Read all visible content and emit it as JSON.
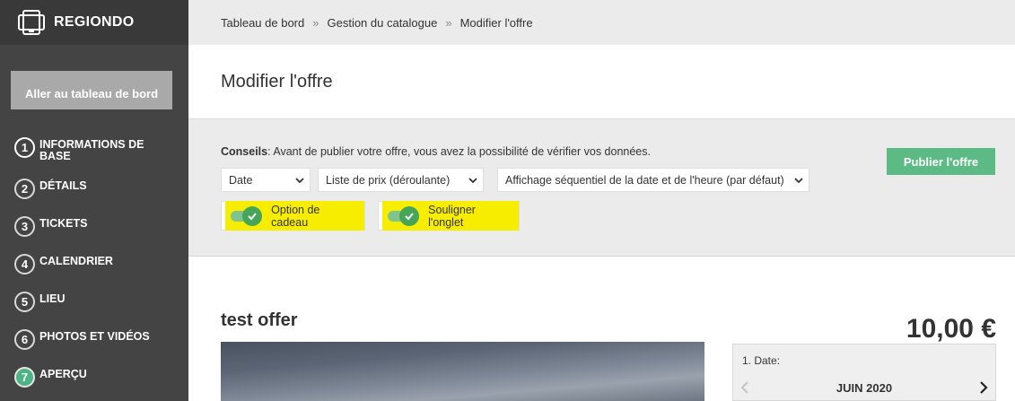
{
  "brand": {
    "name": "REGIONDO"
  },
  "sidebar": {
    "dashboard_button": "Aller au tableau de bord",
    "steps": [
      {
        "num": "1",
        "label": "INFORMATIONS DE BASE"
      },
      {
        "num": "2",
        "label": "DÉTAILS"
      },
      {
        "num": "3",
        "label": "TICKETS"
      },
      {
        "num": "4",
        "label": "CALENDRIER"
      },
      {
        "num": "5",
        "label": "LIEU"
      },
      {
        "num": "6",
        "label": "PHOTOS ET VIDÉOS"
      },
      {
        "num": "7",
        "label": "APERÇU"
      }
    ]
  },
  "breadcrumb": {
    "items": [
      "Tableau de bord",
      "Gestion du catalogue",
      "Modifier l'offre"
    ],
    "separator": "»"
  },
  "page": {
    "title": "Modifier l'offre"
  },
  "tips": {
    "prefix": "Conseils",
    "text": ": Avant de publier votre offre, vous avez la possibilité de vérifier vos données."
  },
  "selects": {
    "date": "Date",
    "price_list": "Liste de prix (déroulante)",
    "display": "Affichage séquentiel de la date et de l'heure (par défaut)"
  },
  "toggles": {
    "gift_option": {
      "label": "Option de cadeau",
      "on": true
    },
    "underline_tab": {
      "label": "Souligner l'onglet",
      "on": true
    }
  },
  "publish_button": "Publier l'offre",
  "offer": {
    "title": "test offer",
    "price": "10,00 €",
    "date_label": "1. Date:",
    "month": "JUIN 2020"
  },
  "colors": {
    "sidebar_bg": "#444444",
    "accent_green": "#5cbb84",
    "highlight": "#f7ed00"
  }
}
